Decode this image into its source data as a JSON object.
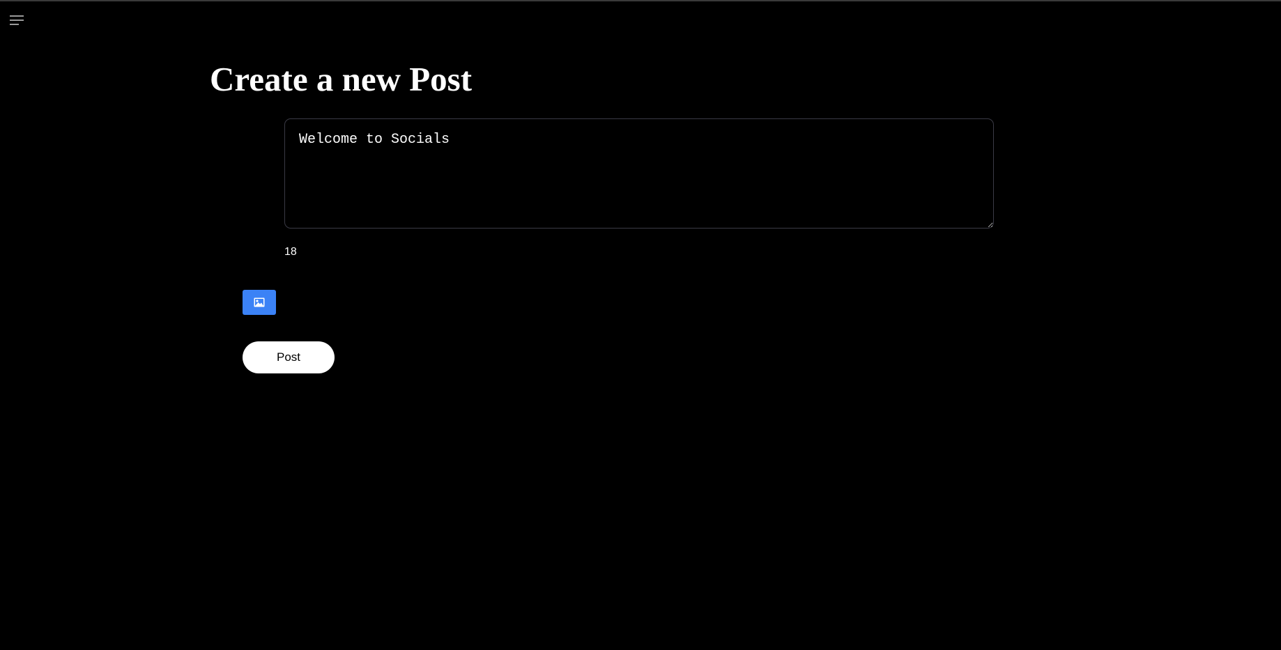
{
  "header": {
    "menu_icon": "hamburger-menu-icon"
  },
  "page": {
    "title": "Create a new Post"
  },
  "composer": {
    "text_value": "Welcome to Socials",
    "char_count": "18"
  },
  "actions": {
    "image_icon": "image-icon",
    "image_button_color": "#3b82f6",
    "post_label": "Post"
  }
}
